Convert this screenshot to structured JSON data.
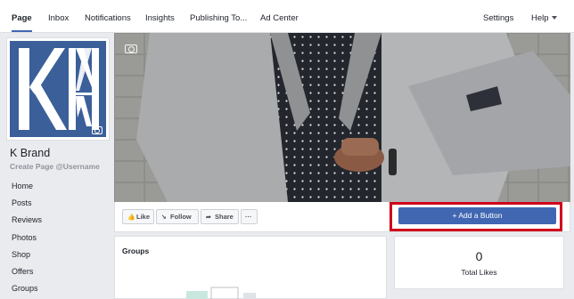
{
  "topnav": {
    "tabs": [
      {
        "label": "Page",
        "active": true
      },
      {
        "label": "Inbox"
      },
      {
        "label": "Notifications"
      },
      {
        "label": "Insights"
      },
      {
        "label": "Publishing To..."
      },
      {
        "label": "Ad Center"
      }
    ],
    "settings_label": "Settings",
    "help_label": "Help"
  },
  "profile": {
    "name": "K Brand",
    "username": "Create Page @Username"
  },
  "sidebar": {
    "items": [
      {
        "label": "Home"
      },
      {
        "label": "Posts"
      },
      {
        "label": "Reviews"
      },
      {
        "label": "Photos"
      },
      {
        "label": "Shop"
      },
      {
        "label": "Offers"
      },
      {
        "label": "Groups"
      }
    ]
  },
  "actions": {
    "like_label": "Like",
    "follow_label": "Follow",
    "share_label": "Share",
    "more_label": "···",
    "add_button_label": "+ Add a Button"
  },
  "groups": {
    "title": "Groups"
  },
  "likes": {
    "count": "0",
    "label": "Total Likes"
  },
  "colors": {
    "accent": "#4267b2",
    "highlight": "#d0021b",
    "logo_bg": "#3b5f99"
  }
}
